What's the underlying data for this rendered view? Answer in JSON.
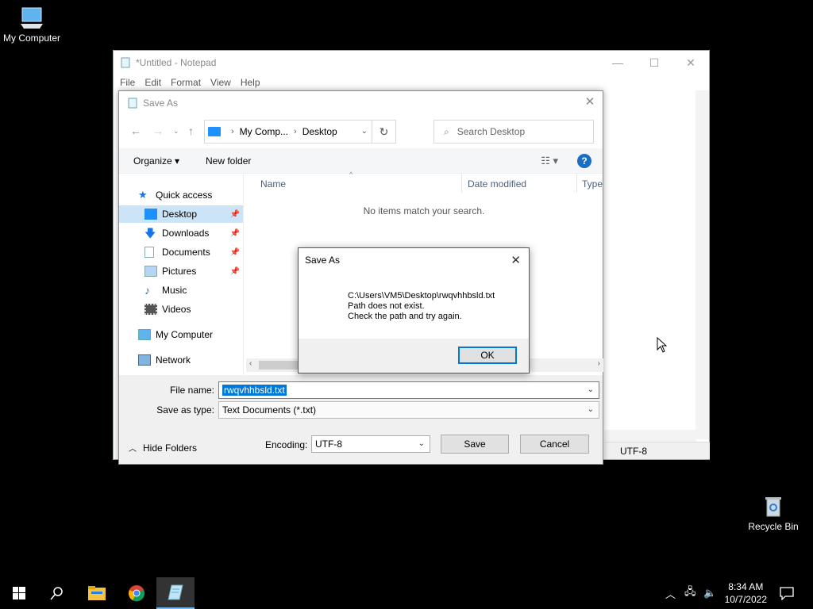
{
  "desktop": {
    "icons": [
      {
        "label": "My Computer",
        "icon": "computer-icon"
      },
      {
        "label": "Recycle Bin",
        "icon": "recycle-bin-icon"
      }
    ]
  },
  "notepad": {
    "title": "*Untitled - Notepad",
    "menu": [
      "File",
      "Edit",
      "Format",
      "View",
      "Help"
    ],
    "status_encoding": "UTF-8"
  },
  "saveas": {
    "title": "Save As",
    "breadcrumb": [
      "My Comp...",
      "Desktop"
    ],
    "search_placeholder": "Search Desktop",
    "organize_label": "Organize ▾",
    "new_folder_label": "New folder",
    "help_label": "?",
    "nav": [
      {
        "label": "Quick access",
        "icon": "star-icon"
      },
      {
        "label": "Desktop",
        "icon": "desktop-icon",
        "pinned": true,
        "selected": true
      },
      {
        "label": "Downloads",
        "icon": "download-arrow-icon",
        "pinned": true
      },
      {
        "label": "Documents",
        "icon": "documents-icon",
        "pinned": true
      },
      {
        "label": "Pictures",
        "icon": "pictures-icon",
        "pinned": true
      },
      {
        "label": "Music",
        "icon": "music-note-icon"
      },
      {
        "label": "Videos",
        "icon": "film-icon"
      },
      {
        "label": "My Computer",
        "icon": "computer-icon"
      },
      {
        "label": "Network",
        "icon": "network-icon"
      }
    ],
    "columns": [
      "Name",
      "Date modified",
      "Type"
    ],
    "empty_message": "No items match your search.",
    "file_name_label": "File name:",
    "file_name_value": "rwqvhhbsld.txt",
    "save_as_type_label": "Save as type:",
    "save_as_type_value": "Text Documents (*.txt)",
    "hide_folders_label": "Hide Folders",
    "encoding_label": "Encoding:",
    "encoding_value": "UTF-8",
    "save_label": "Save",
    "cancel_label": "Cancel"
  },
  "error_dialog": {
    "title": "Save As",
    "line1": "C:\\Users\\VM5\\Desktop\\rwqvhhbsld.txt",
    "line2": "Path does not exist.",
    "line3": "Check the path and try again.",
    "ok_label": "OK"
  },
  "taskbar": {
    "time": "8:34 AM",
    "date": "10/7/2022",
    "apps": [
      "start-icon",
      "search-icon",
      "file-explorer-icon",
      "chrome-icon",
      "notepad-icon"
    ]
  },
  "colors": {
    "accent": "#0078d7",
    "selection": "#cce4f7",
    "desktop": "#000000"
  }
}
